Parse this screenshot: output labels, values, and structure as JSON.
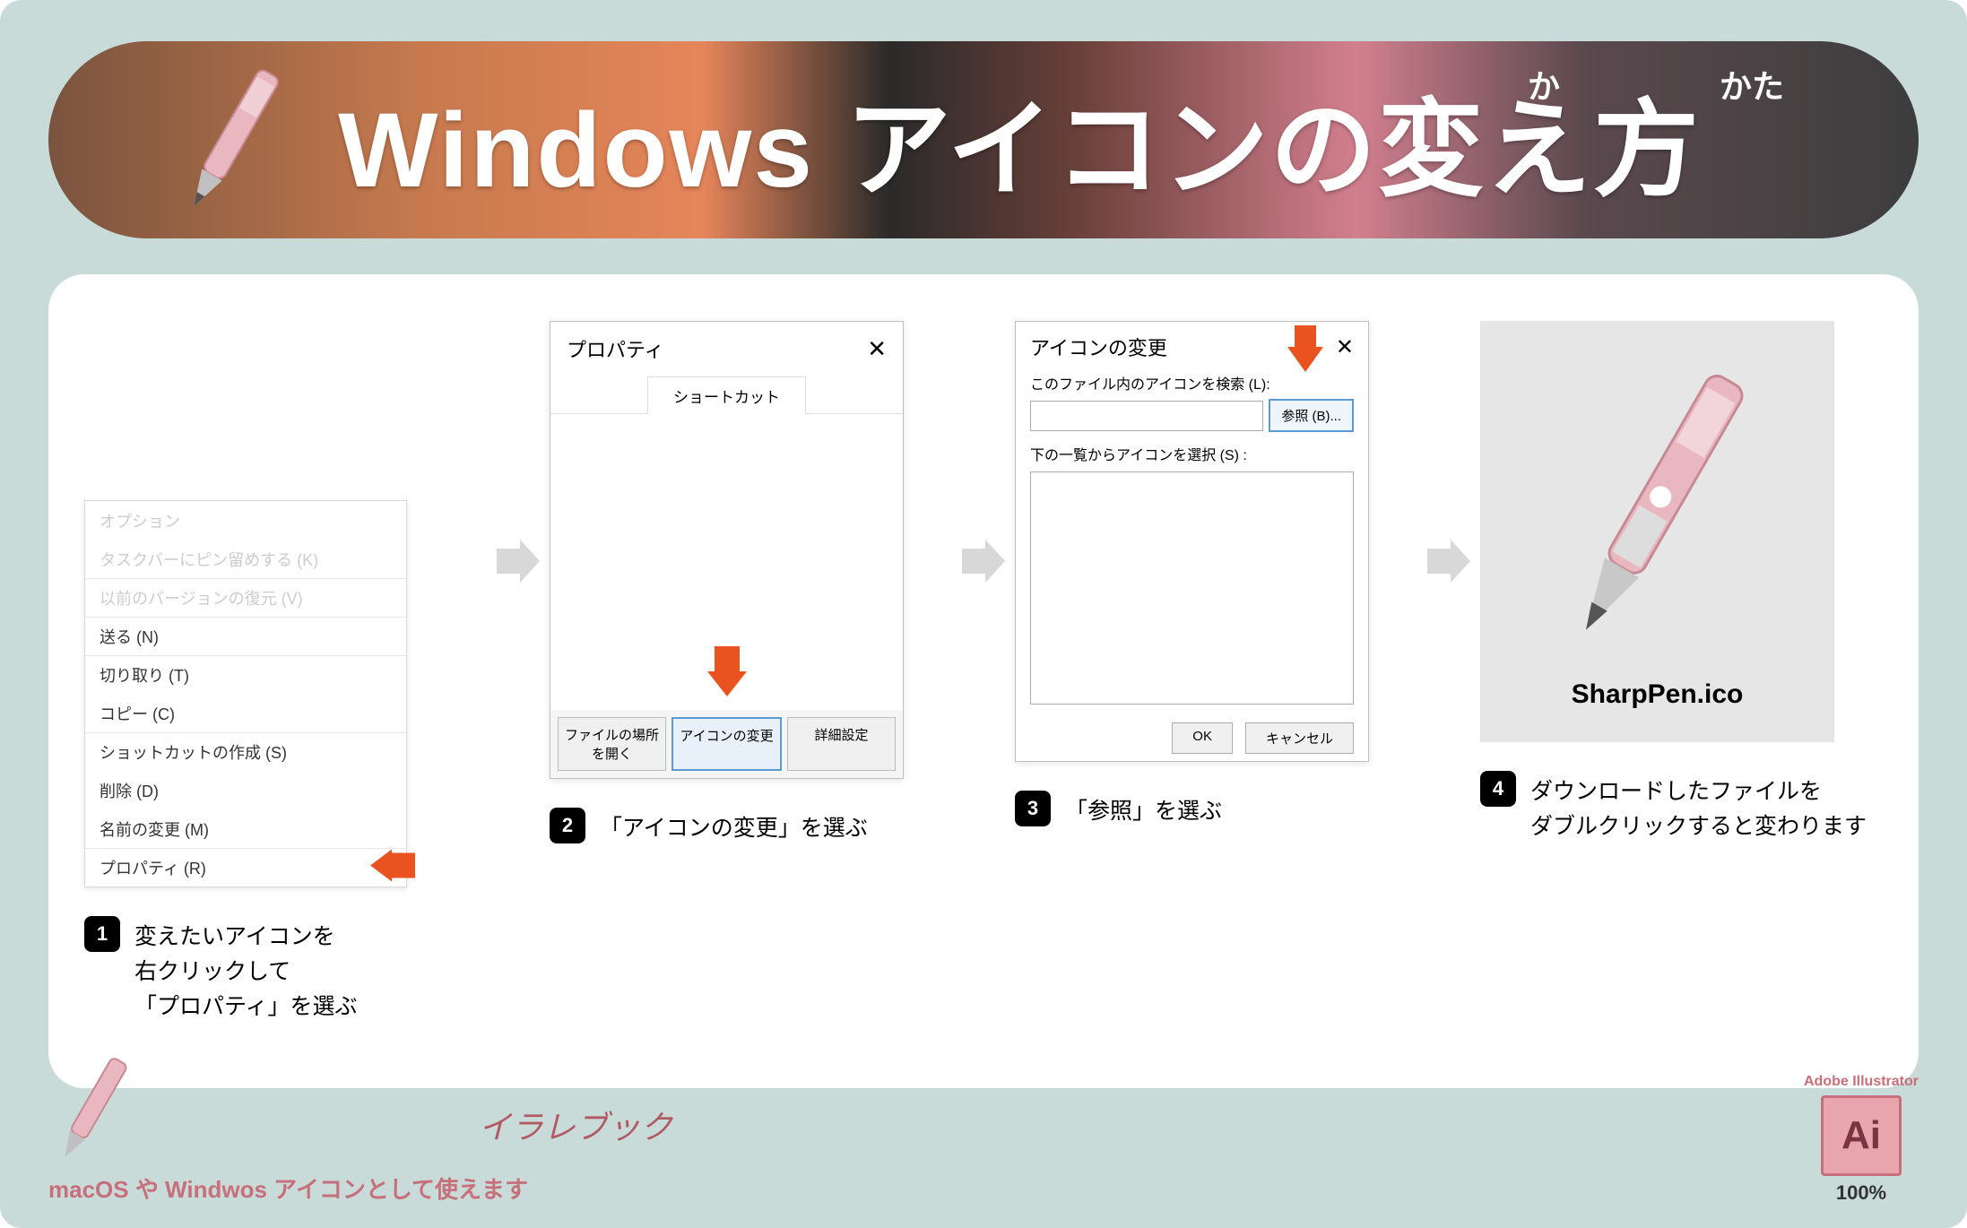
{
  "hero": {
    "title": "Windows アイコンの変え方",
    "furigana1": "か",
    "furigana2": "かた"
  },
  "steps": {
    "s1": {
      "num": "1",
      "text": "変えたいアイコンを\n右クリックして\n「プロパティ」を選ぶ",
      "menu": {
        "i0": "オプション",
        "i1": "タスクバーにピン留めする (K)",
        "i2": "以前のバージョンの復元 (V)",
        "i3": "送る (N)",
        "i4": "切り取り (T)",
        "i5": "コピー (C)",
        "i6": "ショットカットの作成 (S)",
        "i7": "削除 (D)",
        "i8": "名前の変更 (M)",
        "i9": "プロパティ (R)"
      }
    },
    "s2": {
      "num": "2",
      "text": "「アイコンの変更」を選ぶ",
      "dialog": {
        "title": "プロパティ",
        "tab": "ショートカット",
        "btn1": "ファイルの場所を開く",
        "btn2": "アイコンの変更",
        "btn3": "詳細設定"
      }
    },
    "s3": {
      "num": "3",
      "text": "「参照」を選ぶ",
      "dialog": {
        "title": "アイコンの変更",
        "label1": "このファイル内のアイコンを検索 (L):",
        "browse": "参照 (B)...",
        "label2": "下の一覧からアイコンを選択 (S) :",
        "ok": "OK",
        "cancel": "キャンセル"
      }
    },
    "s4": {
      "num": "4",
      "text": "ダウンロードしたファイルを\nダブルクリックすると変わります",
      "filename": "SharpPen.ico"
    }
  },
  "footer": {
    "brand": "イラレブック",
    "sub": "macOS や Windwos アイコンとして使えます",
    "ai_label": "Adobe Illustrator",
    "ai_text": "Ai",
    "ai_pct": "100%"
  }
}
